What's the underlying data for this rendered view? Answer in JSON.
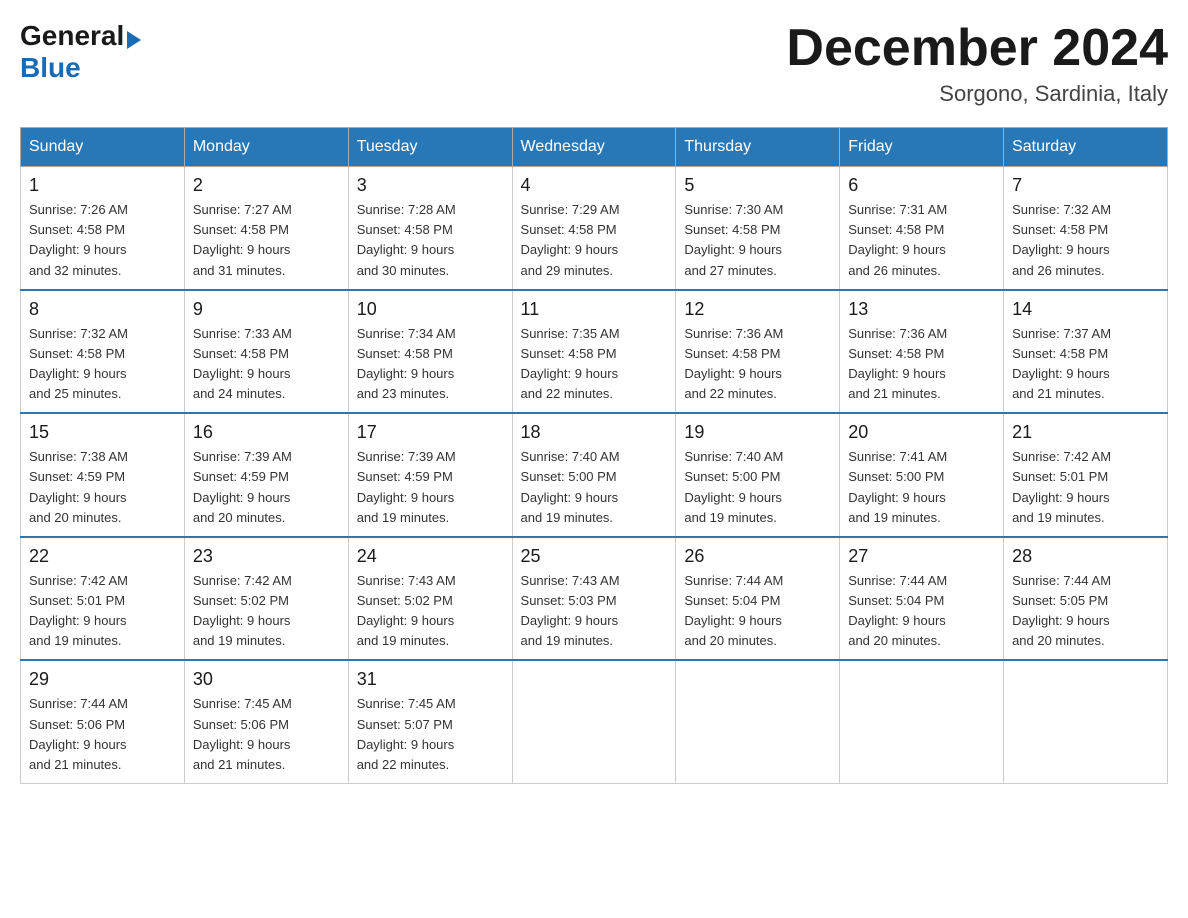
{
  "header": {
    "logo_general": "General",
    "logo_blue": "Blue",
    "month_title": "December 2024",
    "location": "Sorgono, Sardinia, Italy"
  },
  "days_of_week": [
    "Sunday",
    "Monday",
    "Tuesday",
    "Wednesday",
    "Thursday",
    "Friday",
    "Saturday"
  ],
  "weeks": [
    [
      {
        "day": "1",
        "sunrise": "7:26 AM",
        "sunset": "4:58 PM",
        "daylight": "9 hours and 32 minutes."
      },
      {
        "day": "2",
        "sunrise": "7:27 AM",
        "sunset": "4:58 PM",
        "daylight": "9 hours and 31 minutes."
      },
      {
        "day": "3",
        "sunrise": "7:28 AM",
        "sunset": "4:58 PM",
        "daylight": "9 hours and 30 minutes."
      },
      {
        "day": "4",
        "sunrise": "7:29 AM",
        "sunset": "4:58 PM",
        "daylight": "9 hours and 29 minutes."
      },
      {
        "day": "5",
        "sunrise": "7:30 AM",
        "sunset": "4:58 PM",
        "daylight": "9 hours and 27 minutes."
      },
      {
        "day": "6",
        "sunrise": "7:31 AM",
        "sunset": "4:58 PM",
        "daylight": "9 hours and 26 minutes."
      },
      {
        "day": "7",
        "sunrise": "7:32 AM",
        "sunset": "4:58 PM",
        "daylight": "9 hours and 26 minutes."
      }
    ],
    [
      {
        "day": "8",
        "sunrise": "7:32 AM",
        "sunset": "4:58 PM",
        "daylight": "9 hours and 25 minutes."
      },
      {
        "day": "9",
        "sunrise": "7:33 AM",
        "sunset": "4:58 PM",
        "daylight": "9 hours and 24 minutes."
      },
      {
        "day": "10",
        "sunrise": "7:34 AM",
        "sunset": "4:58 PM",
        "daylight": "9 hours and 23 minutes."
      },
      {
        "day": "11",
        "sunrise": "7:35 AM",
        "sunset": "4:58 PM",
        "daylight": "9 hours and 22 minutes."
      },
      {
        "day": "12",
        "sunrise": "7:36 AM",
        "sunset": "4:58 PM",
        "daylight": "9 hours and 22 minutes."
      },
      {
        "day": "13",
        "sunrise": "7:36 AM",
        "sunset": "4:58 PM",
        "daylight": "9 hours and 21 minutes."
      },
      {
        "day": "14",
        "sunrise": "7:37 AM",
        "sunset": "4:58 PM",
        "daylight": "9 hours and 21 minutes."
      }
    ],
    [
      {
        "day": "15",
        "sunrise": "7:38 AM",
        "sunset": "4:59 PM",
        "daylight": "9 hours and 20 minutes."
      },
      {
        "day": "16",
        "sunrise": "7:39 AM",
        "sunset": "4:59 PM",
        "daylight": "9 hours and 20 minutes."
      },
      {
        "day": "17",
        "sunrise": "7:39 AM",
        "sunset": "4:59 PM",
        "daylight": "9 hours and 19 minutes."
      },
      {
        "day": "18",
        "sunrise": "7:40 AM",
        "sunset": "5:00 PM",
        "daylight": "9 hours and 19 minutes."
      },
      {
        "day": "19",
        "sunrise": "7:40 AM",
        "sunset": "5:00 PM",
        "daylight": "9 hours and 19 minutes."
      },
      {
        "day": "20",
        "sunrise": "7:41 AM",
        "sunset": "5:00 PM",
        "daylight": "9 hours and 19 minutes."
      },
      {
        "day": "21",
        "sunrise": "7:42 AM",
        "sunset": "5:01 PM",
        "daylight": "9 hours and 19 minutes."
      }
    ],
    [
      {
        "day": "22",
        "sunrise": "7:42 AM",
        "sunset": "5:01 PM",
        "daylight": "9 hours and 19 minutes."
      },
      {
        "day": "23",
        "sunrise": "7:42 AM",
        "sunset": "5:02 PM",
        "daylight": "9 hours and 19 minutes."
      },
      {
        "day": "24",
        "sunrise": "7:43 AM",
        "sunset": "5:02 PM",
        "daylight": "9 hours and 19 minutes."
      },
      {
        "day": "25",
        "sunrise": "7:43 AM",
        "sunset": "5:03 PM",
        "daylight": "9 hours and 19 minutes."
      },
      {
        "day": "26",
        "sunrise": "7:44 AM",
        "sunset": "5:04 PM",
        "daylight": "9 hours and 20 minutes."
      },
      {
        "day": "27",
        "sunrise": "7:44 AM",
        "sunset": "5:04 PM",
        "daylight": "9 hours and 20 minutes."
      },
      {
        "day": "28",
        "sunrise": "7:44 AM",
        "sunset": "5:05 PM",
        "daylight": "9 hours and 20 minutes."
      }
    ],
    [
      {
        "day": "29",
        "sunrise": "7:44 AM",
        "sunset": "5:06 PM",
        "daylight": "9 hours and 21 minutes."
      },
      {
        "day": "30",
        "sunrise": "7:45 AM",
        "sunset": "5:06 PM",
        "daylight": "9 hours and 21 minutes."
      },
      {
        "day": "31",
        "sunrise": "7:45 AM",
        "sunset": "5:07 PM",
        "daylight": "9 hours and 22 minutes."
      },
      null,
      null,
      null,
      null
    ]
  ],
  "labels": {
    "sunrise": "Sunrise: ",
    "sunset": "Sunset: ",
    "daylight": "Daylight: "
  }
}
